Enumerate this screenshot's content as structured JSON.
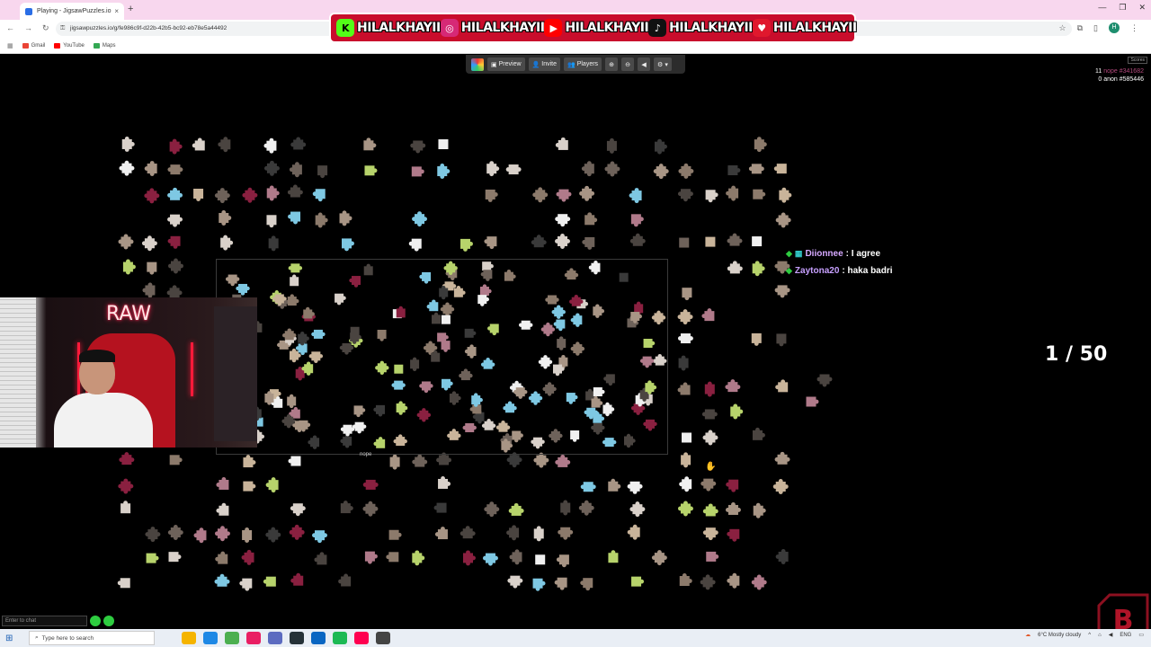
{
  "browser": {
    "tab_title": "Playing - JigsawPuzzles.io",
    "tab_close": "×",
    "new_tab": "+",
    "url": "jigsawpuzzles.io/g/fe986c9f-d22b-42b5-bc92-eb78e5a44492",
    "bookmarks": [
      {
        "label": "Gmail",
        "color": "#ea4335"
      },
      {
        "label": "YouTube",
        "color": "#ff0000"
      },
      {
        "label": "Maps",
        "color": "#34a853"
      }
    ],
    "profile_initial": "H"
  },
  "banner": {
    "handle": "HILALKHAYII",
    "networks": [
      {
        "name": "kick",
        "glyph": "K",
        "bg": "#53fc18",
        "fg": "#000"
      },
      {
        "name": "instagram",
        "glyph": "◎",
        "bg": "#d62976",
        "fg": "#fff"
      },
      {
        "name": "youtube",
        "glyph": "▶",
        "bg": "#ff0000",
        "fg": "#fff"
      },
      {
        "name": "tiktok",
        "glyph": "♪",
        "bg": "#111",
        "fg": "#fff"
      },
      {
        "name": "twitter",
        "glyph": "♥",
        "bg": "#e0182d",
        "fg": "#fff"
      }
    ]
  },
  "game_toolbar": {
    "preview_label": "Preview",
    "invite_label": "Invite",
    "players_label": "Players"
  },
  "scores": {
    "button_label": "Scores",
    "rows": [
      {
        "score": "11",
        "name": "nope #341682"
      },
      {
        "score": "0",
        "name": "anon #585446"
      }
    ]
  },
  "board": {
    "player_tag": "nope"
  },
  "webcam": {
    "neon_text": "RAW"
  },
  "chat": {
    "messages": [
      {
        "user": "Diionnee",
        "text": ": I agree"
      },
      {
        "user": "Zaytona20",
        "text": ": haka badri"
      }
    ],
    "input_placeholder": "Enter to chat"
  },
  "progress": {
    "counter": "1 / 50"
  },
  "taskbar": {
    "search_placeholder": "Type here to search",
    "weather": "6°C  Mostly cloudy",
    "lang": "ENG",
    "app_colors": [
      "#f5b400",
      "#1e88e5",
      "#4caf50",
      "#e91e63",
      "#5c6bc0",
      "#263238",
      "#0a66c2",
      "#1db954",
      "#ff0050",
      "#444"
    ]
  },
  "colors": {
    "accent": "#c90d2c",
    "page_bg": "#000000",
    "piece_palette": [
      "#8c7a6b",
      "#a89585",
      "#d9d1ca",
      "#f0f0f0",
      "#6e625a",
      "#4a4440",
      "#b07a8a",
      "#8a2040",
      "#7ec8e3",
      "#b7d36b",
      "#3a3a3a",
      "#c9b49a"
    ]
  }
}
